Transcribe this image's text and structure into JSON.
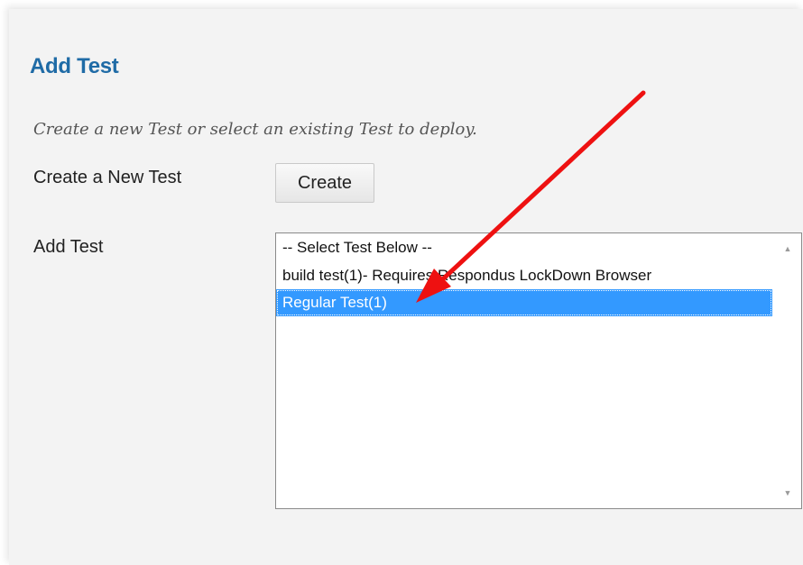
{
  "form": {
    "title": "Add Test",
    "instructions": "Create a new Test or select an existing Test to deploy.",
    "create_label": "Create a New Test",
    "create_button": "Create",
    "add_label": "Add Test"
  },
  "test_list": {
    "options": [
      "-- Select Test Below --",
      "build test(1)- Requires Respondus LockDown Browser",
      "Regular Test(1)"
    ],
    "selected": "Regular Test(1)"
  },
  "colors": {
    "title": "#1f6ba6",
    "selection": "#3399ff",
    "annotation_arrow": "#ee1111"
  },
  "icons": {
    "scroll_up": "scroll-up-arrow-icon",
    "scroll_down": "scroll-down-arrow-icon",
    "annotation": "red-arrow-annotation"
  }
}
